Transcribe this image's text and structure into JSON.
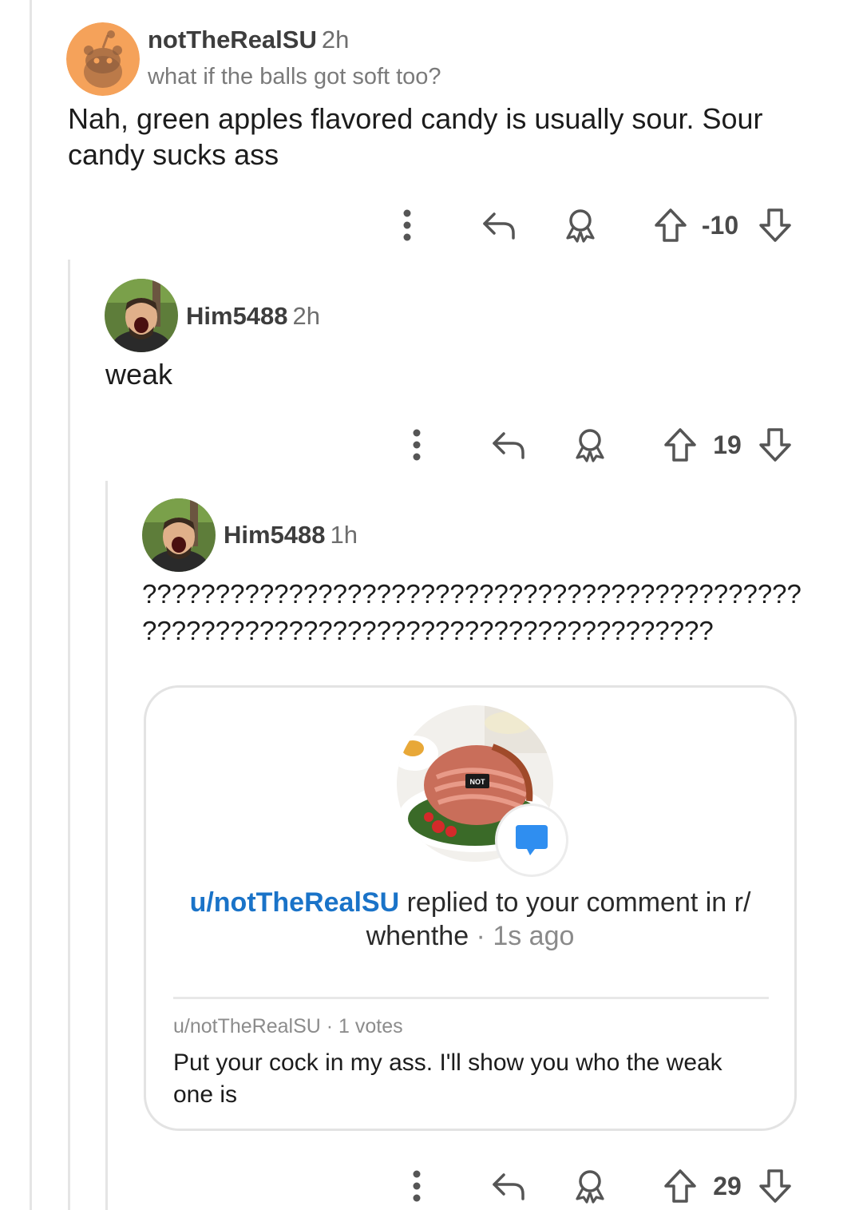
{
  "comments": [
    {
      "username": "notTheRealSU",
      "time": "2h",
      "parent_excerpt": "what if the balls got soft too?",
      "body": "Nah, green apples flavored candy is usually sour. Sour candy sucks ass",
      "score": "-10",
      "avatar_icon": "snoo-avatar-icon"
    },
    {
      "username": "Him5488",
      "time": "2h",
      "body": "weak",
      "score": "19",
      "avatar_icon": "profile-photo-icon"
    },
    {
      "username": "Him5488",
      "time": "1h",
      "body_line1": "?????????????????????????????????????????????",
      "body_line2": "???????????????????????????????????????",
      "score": "29",
      "avatar_icon": "profile-photo-icon",
      "embedded_notification": {
        "image_badge": "NOT",
        "replier": "u/notTheRealSU",
        "action_text": " replied to your comment in r/",
        "subreddit_tail": "whenthe",
        "separator": " · ",
        "ago": "1s ago",
        "meta": "u/notTheRealSU · 1 votes",
        "reply_body": "Put your cock in my ass. I'll show you who the weak one is",
        "image_icon": "ham-dinner-image",
        "badge_icon": "chat-bubble-icon"
      }
    }
  ],
  "action_icons": [
    "more-options-icon",
    "reply-icon",
    "award-icon",
    "upvote-icon",
    "downvote-icon"
  ],
  "colors": {
    "link_blue": "#1a73c8",
    "notif_blue": "#2f8ef0",
    "snoo_orange": "#f5a25a"
  }
}
